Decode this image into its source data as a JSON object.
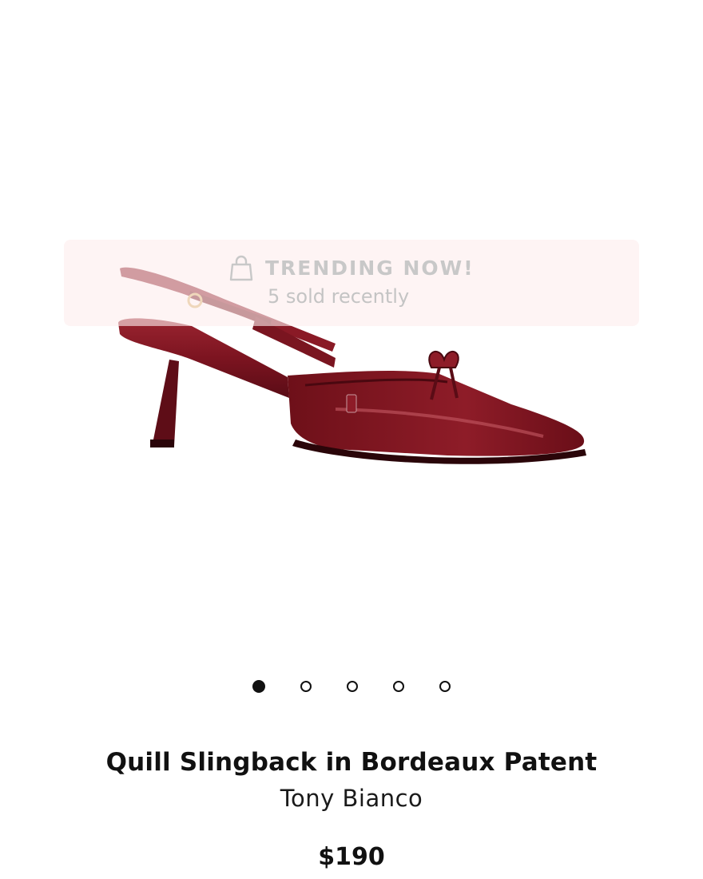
{
  "product": {
    "name": "Quill Slingback in Bordeaux Patent",
    "brand": "Tony Bianco",
    "price": "$190",
    "image_icon": "slingback-shoe-image",
    "color": "#7c1420"
  },
  "trending": {
    "icon": "shopping-bag-icon",
    "title": "TRENDING NOW!",
    "subtitle": "5 sold recently"
  },
  "gallery": {
    "slide_count": 5,
    "active_index": 0
  }
}
